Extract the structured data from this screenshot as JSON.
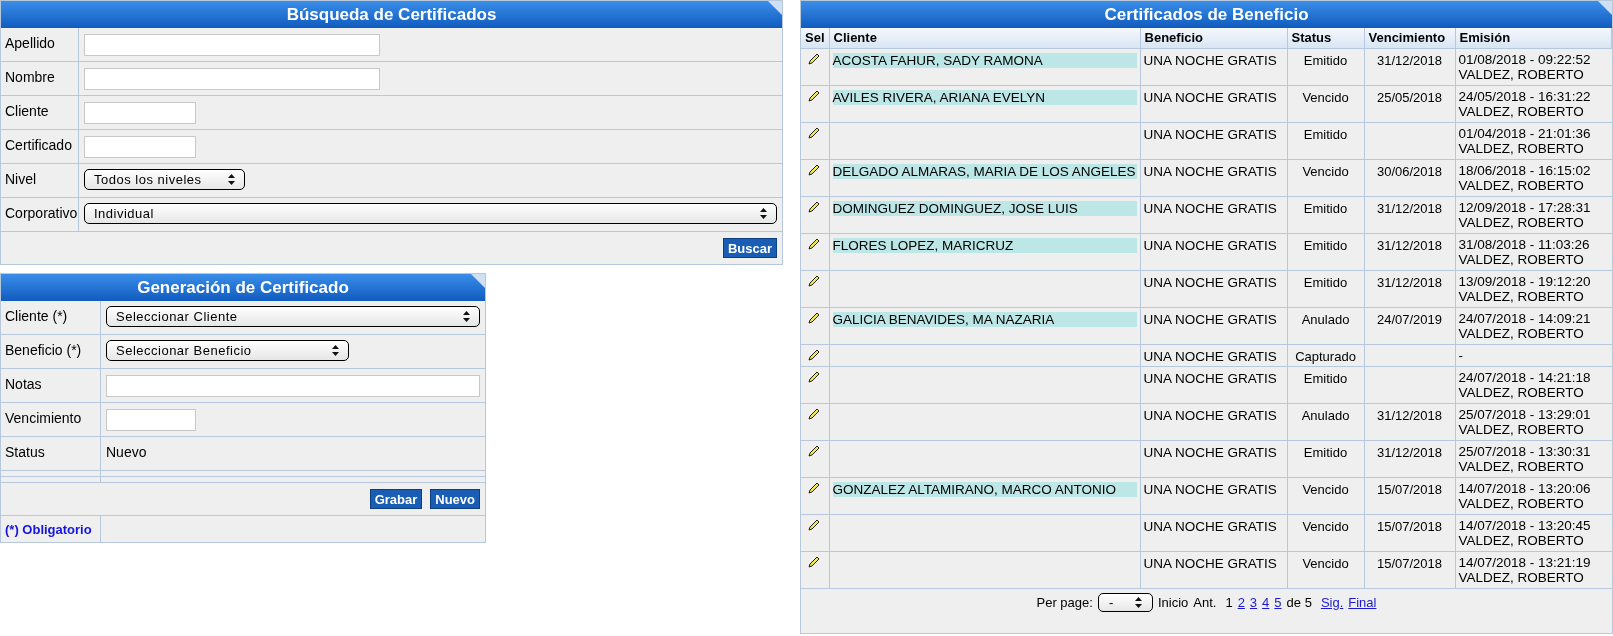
{
  "search_panel": {
    "title": "Búsqueda de Certificados",
    "fields": [
      {
        "label": "Apellido",
        "kind": "text"
      },
      {
        "label": "Nombre",
        "kind": "text"
      },
      {
        "label": "Cliente",
        "kind": "text"
      },
      {
        "label": "Certificado",
        "kind": "text"
      },
      {
        "label": "Nivel",
        "kind": "select",
        "value": "Todos los niveles"
      },
      {
        "label": "Corporativo",
        "kind": "select",
        "value": "Individual"
      }
    ],
    "buttons": [
      "Buscar"
    ]
  },
  "generation_panel": {
    "title": "Generación de Certificado",
    "fields": [
      {
        "label": "Cliente (*)",
        "kind": "select",
        "value": "Seleccionar Cliente"
      },
      {
        "label": "Beneficio (*)",
        "kind": "select",
        "value": "Seleccionar Beneficio"
      },
      {
        "label": "Notas",
        "kind": "text"
      },
      {
        "label": "Vencimiento",
        "kind": "text"
      },
      {
        "label": "Status",
        "kind": "static",
        "value": "Nuevo"
      }
    ],
    "buttons": [
      "Grabar",
      "Nuevo"
    ],
    "footnote": "(*) Obligatorio"
  },
  "results_panel": {
    "title": "Certificados de Beneficio",
    "columns": [
      "Sel",
      "Cliente",
      "Beneficio",
      "Status",
      "Vencimiento",
      "Emisión"
    ],
    "rows": [
      {
        "client": "ACOSTA FAHUR, SADY RAMONA",
        "benefit": "UNA NOCHE GRATIS",
        "status": "Emitido",
        "expiry": "31/12/2018",
        "issued": [
          "01/08/2018 - 09:22:52",
          "VALDEZ, ROBERTO"
        ]
      },
      {
        "client": "AVILES RIVERA, ARIANA EVELYN",
        "benefit": "UNA NOCHE GRATIS",
        "status": "Vencido",
        "expiry": "25/05/2018",
        "issued": [
          "24/05/2018 - 16:31:22",
          "VALDEZ, ROBERTO"
        ]
      },
      {
        "benefit": "UNA NOCHE GRATIS",
        "status": "Emitido",
        "issued": [
          "01/04/2018 - 21:01:36",
          "VALDEZ, ROBERTO"
        ]
      },
      {
        "client": "DELGADO ALMARAS, MARIA DE LOS ANGELES",
        "benefit": "UNA NOCHE GRATIS",
        "status": "Vencido",
        "expiry": "30/06/2018",
        "issued": [
          "18/06/2018 - 16:15:02",
          "VALDEZ, ROBERTO"
        ]
      },
      {
        "client": "DOMINGUEZ DOMINGUEZ, JOSE LUIS",
        "benefit": "UNA NOCHE GRATIS",
        "status": "Emitido",
        "expiry": "31/12/2018",
        "issued": [
          "12/09/2018 - 17:28:31",
          "VALDEZ, ROBERTO"
        ]
      },
      {
        "client": "FLORES LOPEZ, MARICRUZ",
        "benefit": "UNA NOCHE GRATIS",
        "status": "Emitido",
        "expiry": "31/12/2018",
        "issued": [
          "31/08/2018 - 11:03:26",
          "VALDEZ, ROBERTO"
        ]
      },
      {
        "benefit": "UNA NOCHE GRATIS",
        "status": "Emitido",
        "expiry": "31/12/2018",
        "issued": [
          "13/09/2018 - 19:12:20",
          "VALDEZ, ROBERTO"
        ]
      },
      {
        "client": "GALICIA BENAVIDES, MA NAZARIA",
        "benefit": "UNA NOCHE GRATIS",
        "status": "Anulado",
        "expiry": "24/07/2019",
        "issued": [
          "24/07/2018 - 14:09:21",
          "VALDEZ, ROBERTO"
        ]
      },
      {
        "benefit": "UNA NOCHE GRATIS",
        "status": "Capturado",
        "issued": [
          "-"
        ]
      },
      {
        "benefit": "UNA NOCHE GRATIS",
        "status": "Emitido",
        "issued": [
          "24/07/2018 - 14:21:18",
          "VALDEZ, ROBERTO"
        ]
      },
      {
        "benefit": "UNA NOCHE GRATIS",
        "status": "Anulado",
        "expiry": "31/12/2018",
        "issued": [
          "25/07/2018 - 13:29:01",
          "VALDEZ, ROBERTO"
        ]
      },
      {
        "benefit": "UNA NOCHE GRATIS",
        "status": "Emitido",
        "expiry": "31/12/2018",
        "issued": [
          "25/07/2018 - 13:30:31",
          "VALDEZ, ROBERTO"
        ]
      },
      {
        "client": "GONZALEZ ALTAMIRANO, MARCO ANTONIO",
        "benefit": "UNA NOCHE GRATIS",
        "status": "Vencido",
        "expiry": "15/07/2018",
        "issued": [
          "14/07/2018 - 13:20:06",
          "VALDEZ, ROBERTO"
        ]
      },
      {
        "benefit": "UNA NOCHE GRATIS",
        "status": "Vencido",
        "expiry": "15/07/2018",
        "issued": [
          "14/07/2018 - 13:20:45",
          "VALDEZ, ROBERTO"
        ]
      },
      {
        "benefit": "UNA NOCHE GRATIS",
        "status": "Vencido",
        "expiry": "15/07/2018",
        "issued": [
          "14/07/2018 - 13:21:19",
          "VALDEZ, ROBERTO"
        ]
      }
    ],
    "pagination": {
      "per_page_label": "Per page:",
      "per_page_value": "-",
      "first": "Inicio",
      "prev": "Ant.",
      "pages": [
        {
          "label": "1",
          "selected": true
        },
        {
          "label": "2",
          "selected": false
        },
        {
          "label": "3",
          "selected": false
        },
        {
          "label": "4",
          "selected": false
        },
        {
          "label": "5",
          "selected": false
        }
      ],
      "of": "de 5",
      "next": "Sig.",
      "last": "Final"
    }
  }
}
